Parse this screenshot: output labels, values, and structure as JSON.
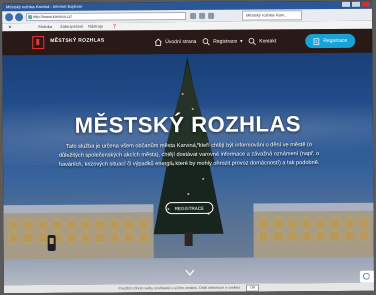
{
  "browser": {
    "window_title": "Městský rozhlas Karviná - Internet Explorer",
    "url": "http://www.karvina.cz/",
    "tab_title": "Městský rozhlas Karv...",
    "menu": [
      "★",
      "Stránka",
      "Zabezpečení",
      "Nástroje",
      "❓"
    ]
  },
  "site": {
    "brand": "MĚSTSKÝ ROZHLAS",
    "nav": {
      "home": "Úvodní strana",
      "registration": "Registrace",
      "contact": "Kontakt",
      "register_button": "Registrace"
    },
    "hero": {
      "title": "MĚSTSKÝ ROZHLAS",
      "text": "Tato služba je určena všem občanům města Karviná, kteří chtějí být informováni o dění ve městě (o důležitých společenských akcích města), chtějí dostávat varovné informace a závažná oznámení (např. o haváriích, krizových situací či výpadků energií, které by mohly ohrozit provoz domácností) a tak podobně.",
      "button": "REGISTRACE"
    },
    "cookie_bar": {
      "text": "Použitím tohoto webu souhlasíte s užitím cookies. Další informace o cookies",
      "button": "OK"
    }
  },
  "colors": {
    "nav_bg": "#2a1a17",
    "accent": "#17a3d8",
    "logo_red": "#e33"
  }
}
